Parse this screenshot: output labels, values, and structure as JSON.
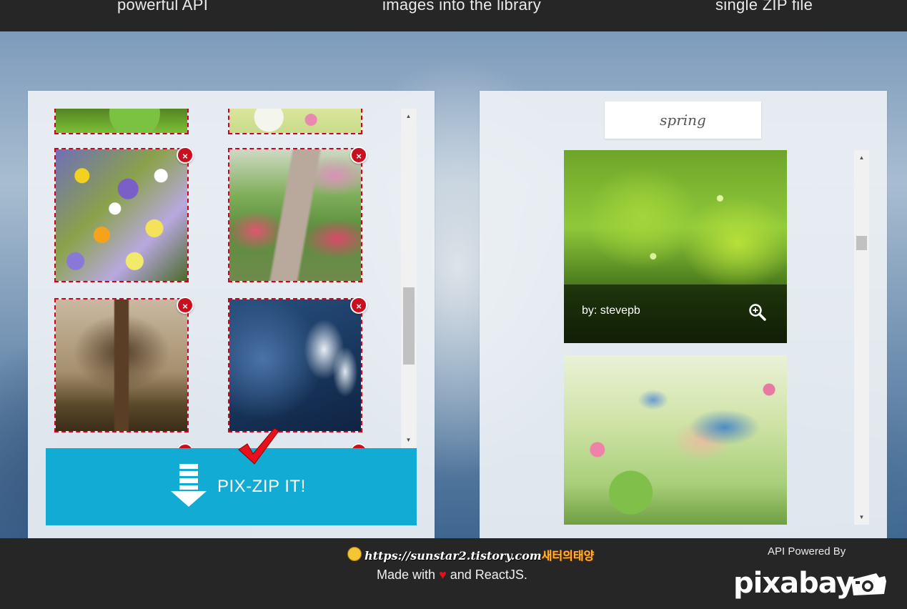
{
  "header": {
    "col1": "powerful API",
    "col2": "images into the library",
    "col3": "single ZIP file"
  },
  "selection": {
    "remove_label": "×",
    "tiles": [
      {
        "name": "green-leaves-partial"
      },
      {
        "name": "white-flowers-partial"
      },
      {
        "name": "wildflowers"
      },
      {
        "name": "garden-path"
      },
      {
        "name": "bare-tree"
      },
      {
        "name": "white-lily"
      }
    ]
  },
  "zip": {
    "label": "PIX-ZIP IT!"
  },
  "search": {
    "value": "spring"
  },
  "results": [
    {
      "author": "by: stevepb"
    },
    {
      "author": ""
    }
  ],
  "footer": {
    "link": "https://sunstar2.tistory.com",
    "korean": "새터의태양",
    "made_with_prefix": "Made with",
    "made_with_suffix": "and ReactJS.",
    "api_powered": "API Powered By",
    "logo": "pixabay"
  },
  "colors": {
    "accent": "#12abd3",
    "remove": "#c8101e",
    "heart": "#e0131a",
    "header_bg": "#262626"
  },
  "icons": [
    "download-icon",
    "checkmark-icon",
    "remove-icon",
    "zoom-in-icon",
    "heart-icon",
    "camera-icon",
    "emoji-icon"
  ]
}
